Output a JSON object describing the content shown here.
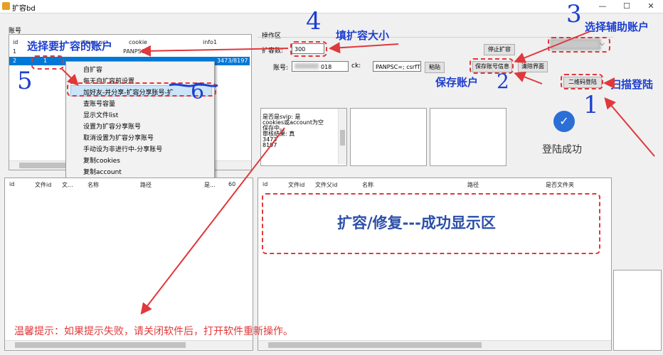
{
  "window": {
    "title": "扩容bd",
    "min": "—",
    "max": "☐",
    "close": "✕"
  },
  "accounts": {
    "group_label": "账号",
    "columns": [
      "id",
      "share_uc",
      "cookie",
      "info1"
    ],
    "rows": [
      {
        "id": "1",
        "share": "",
        "cookie": "PANPSC=",
        "info": ""
      },
      {
        "id": "2",
        "share": "1",
        "cookie": "",
        "info": "3473/8197"
      }
    ]
  },
  "context_menu": {
    "items": [
      "自扩容",
      "每天自扩容前设置",
      "加好友-并分享-扩容分享账号-扩",
      "查账号容量",
      "显示文件list",
      "设置为扩容分享账号",
      "取消设置为扩容分享账号",
      "手动设为非进行中-分享账号",
      "复制cookies",
      "复制account"
    ]
  },
  "ops": {
    "label": "操作区",
    "expand_label": "扩容数:",
    "expand_value": "300",
    "stop_button": "停止扩容",
    "account_label": "账号:",
    "account_value": "018",
    "ck_label": "ck:",
    "ck_value": "PANPSC=; csrfT",
    "paste_button": "粘贴",
    "save_button": "保存账号信息",
    "clear_button": "清除界面",
    "qr_button": "二维码登陆",
    "combo_arrow": "⌵"
  },
  "log": {
    "lines": [
      "是否是svip: 是",
      "cookies或account为空",
      "保存中。。",
      "审核结果: 真",
      "3473",
      "8197"
    ]
  },
  "login": {
    "status": "登陆成功",
    "check": "✓"
  },
  "left_table": {
    "columns": [
      "id",
      "文件id",
      "文...",
      "名称",
      "路径",
      "是...",
      "60"
    ]
  },
  "right_table": {
    "columns": [
      "id",
      "文件id",
      "文件父id",
      "名称",
      "路径",
      "是否文件夹"
    ]
  },
  "annotations": {
    "a1_num": "1",
    "a1_text": "扫描登陆",
    "a2_num": "2",
    "a2_text": "保存账户",
    "a3_num": "3",
    "a3_text": "选择辅助账户",
    "a4_num": "4",
    "a4_text": "填扩容大小",
    "a5_num": "5",
    "a5_text": "选择要扩容的账户",
    "a6_num": "6",
    "success_area": "扩容/修复---成功显示区",
    "tip": "温馨提示：如果提示失败，请关闭软件后，打开软件重新操作。"
  },
  "colors": {
    "annotation_blue": "#1e3fcf",
    "annotation_red": "#e0383b",
    "selection_blue": "#0078d7",
    "success_blue": "#2b6fd6"
  }
}
